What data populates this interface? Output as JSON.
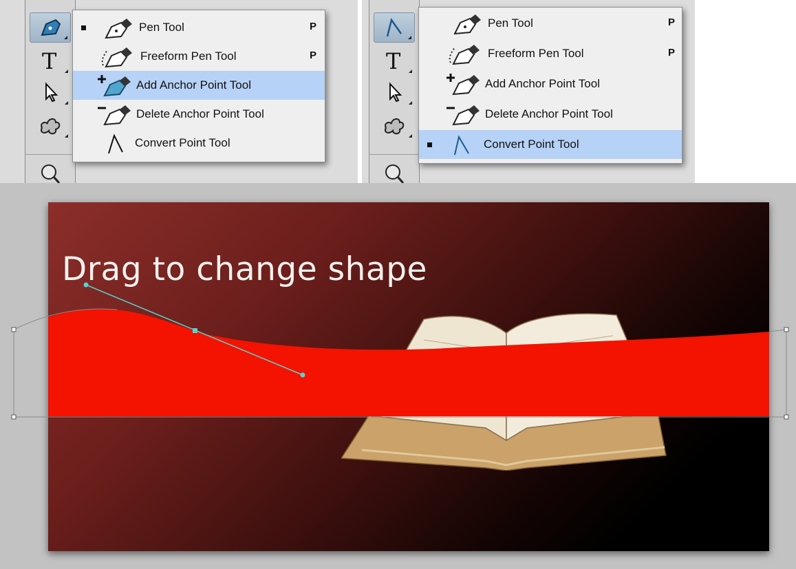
{
  "left_menu": {
    "items": [
      {
        "label": "Pen Tool",
        "shortcut": "P",
        "icon": "pen-icon",
        "selected": true
      },
      {
        "label": "Freeform Pen Tool",
        "shortcut": "P",
        "icon": "freeform-pen-icon"
      },
      {
        "label": "Add Anchor Point Tool",
        "shortcut": "",
        "icon": "add-anchor-point-icon",
        "highlighted": true
      },
      {
        "label": "Delete Anchor Point Tool",
        "shortcut": "",
        "icon": "delete-anchor-point-icon"
      },
      {
        "label": "Convert Point Tool",
        "shortcut": "",
        "icon": "convert-point-icon"
      }
    ]
  },
  "right_menu": {
    "items": [
      {
        "label": "Pen Tool",
        "shortcut": "P",
        "icon": "pen-icon"
      },
      {
        "label": "Freeform Pen Tool",
        "shortcut": "P",
        "icon": "freeform-pen-icon"
      },
      {
        "label": "Add Anchor Point Tool",
        "shortcut": "",
        "icon": "add-anchor-point-icon"
      },
      {
        "label": "Delete Anchor Point Tool",
        "shortcut": "",
        "icon": "delete-anchor-point-icon"
      },
      {
        "label": "Convert Point Tool",
        "shortcut": "",
        "icon": "convert-point-icon",
        "selected": true,
        "highlighted": true
      }
    ]
  },
  "toolbar": {
    "tools": [
      "pen-icon",
      "type-icon",
      "path-selection-icon",
      "custom-shape-icon",
      "zoom-icon"
    ]
  },
  "slide": {
    "title": "Drag to change shape"
  },
  "colors": {
    "menu_highlight": "#b7d2f7",
    "wave_fill": "#f41200",
    "anchor_handle": "#52d6d0",
    "bg_start": "#8c2e2a"
  }
}
